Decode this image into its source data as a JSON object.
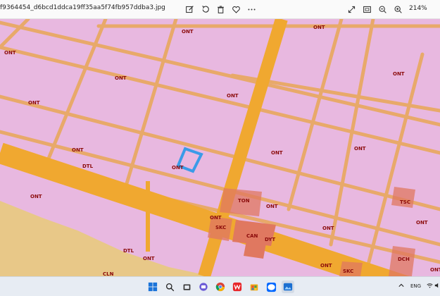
{
  "window": {
    "title": "f9364454_d6bcd1ddca19ff35aa5f74fb957ddba3.jpg",
    "zoom_level": "214%"
  },
  "toolbar": {
    "left_icons": [
      "edit-icon",
      "rotate-icon",
      "delete-icon",
      "favorite-icon",
      "more-icon"
    ],
    "right_icons": [
      "fullscreen-icon",
      "fit-to-window-icon",
      "zoom-out-icon",
      "zoom-in-icon"
    ]
  },
  "map": {
    "colors": {
      "residential": "#e8b8e0",
      "road": "#f0a830",
      "commercial": "#e07860",
      "highlight": "#3a9be8",
      "farmland": "#e8c888"
    },
    "labels": [
      {
        "text": "ONT",
        "id": "ont-1"
      },
      {
        "text": "ONT",
        "id": "ont-2"
      },
      {
        "text": "ONT",
        "id": "ont-3"
      },
      {
        "text": "ONT",
        "id": "ont-4"
      },
      {
        "text": "ONT",
        "id": "ont-5"
      },
      {
        "text": "ONT",
        "id": "ont-6"
      },
      {
        "text": "ONT",
        "id": "ont-7"
      },
      {
        "text": "ONT",
        "id": "ont-8"
      },
      {
        "text": "ONT",
        "id": "ont-9"
      },
      {
        "text": "ONT",
        "id": "ont-10"
      },
      {
        "text": "ONT",
        "id": "ont-11"
      },
      {
        "text": "ONT",
        "id": "ont-12"
      },
      {
        "text": "ONT",
        "id": "ont-13"
      },
      {
        "text": "ONT",
        "id": "ont-14"
      },
      {
        "text": "ONT",
        "id": "ont-15"
      },
      {
        "text": "ONT",
        "id": "ont-16"
      },
      {
        "text": "ONT",
        "id": "ont-17"
      },
      {
        "text": "ONT",
        "id": "ont-18"
      },
      {
        "text": "ONT",
        "id": "ont-19"
      },
      {
        "text": "DTL",
        "id": "dtl-1"
      },
      {
        "text": "DTL",
        "id": "dtl-2"
      },
      {
        "text": "TON",
        "id": "ton"
      },
      {
        "text": "SKC",
        "id": "skc-1"
      },
      {
        "text": "SKC",
        "id": "skc-2"
      },
      {
        "text": "CAN",
        "id": "can"
      },
      {
        "text": "DYT",
        "id": "dyt"
      },
      {
        "text": "TSC",
        "id": "tsc"
      },
      {
        "text": "DCH",
        "id": "dch"
      },
      {
        "text": "CLN",
        "id": "cln"
      }
    ]
  },
  "taskbar": {
    "icons": [
      "windows-start-icon",
      "search-icon",
      "task-view-icon",
      "chat-icon",
      "chrome-icon",
      "wps-icon",
      "store-icon",
      "zalo-icon",
      "photos-icon"
    ],
    "tray": {
      "language": "ENG"
    }
  }
}
